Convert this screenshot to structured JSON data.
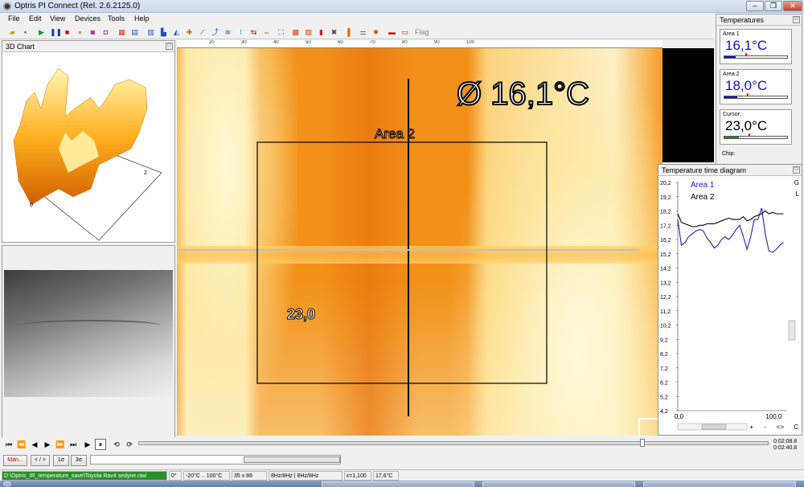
{
  "window": {
    "title": "Optris PI Connect (Rel. 2.6.2125.0)",
    "min_label": "–",
    "max_label": "❐",
    "close_label": "✕"
  },
  "menu": [
    "File",
    "Edit",
    "View",
    "Devices",
    "Tools",
    "Help"
  ],
  "toolbar": {
    "flag_label": "Flag"
  },
  "chart3d": {
    "title": "3D Chart",
    "axis_label_0": "0",
    "axis_label_2": "2"
  },
  "ruler": {
    "labels": [
      "20",
      "30",
      "40",
      "50",
      "60",
      "70",
      "80",
      "90",
      "100"
    ]
  },
  "thermal": {
    "mean_label": "Ø   16,1°C",
    "area_label": "Area 2",
    "cursor_label": "23,0"
  },
  "temperatures": {
    "title": "Temperatures",
    "items": [
      {
        "label": "Area 1",
        "value": "16,1°C",
        "color": "#1010c8",
        "level": 0.18
      },
      {
        "label": "Area 2",
        "value": "18,0°C",
        "color": "#1010c8",
        "level": 0.2
      },
      {
        "label": "Cursor:",
        "value": "23,0°C",
        "color": "#000000",
        "level": 0.23
      }
    ],
    "chip_label": "Chip:"
  },
  "time_diagram": {
    "title": "Temperature time diagram",
    "legend": [
      {
        "name": "Area 1",
        "color": "#2020c0"
      },
      {
        "name": "Area 2",
        "color": "#000000"
      }
    ],
    "side_labels": [
      "G",
      "L"
    ],
    "bottom_controls": [
      "+",
      "-",
      "<>",
      "C"
    ],
    "chart_data": {
      "type": "line",
      "xlabel": "",
      "ylabel": "",
      "x_ticks": [
        "0,0",
        "100,0"
      ],
      "xlim": [
        0,
        120
      ],
      "ylim": [
        4.2,
        20.2
      ],
      "y_ticks": [
        "20,2",
        "19,2",
        "18,2",
        "17,2",
        "16,2",
        "15,2",
        "14,2",
        "13,2",
        "12,2",
        "11,2",
        "10,2",
        "9,2",
        "8,2",
        "7,2",
        "6,2",
        "5,2",
        "4,2"
      ],
      "series": [
        {
          "name": "Area 1",
          "color": "#2020c0",
          "x": [
            0,
            4,
            8,
            12,
            16,
            20,
            24,
            28,
            32,
            36,
            40,
            44,
            48,
            52,
            56,
            60,
            64,
            68,
            72,
            76,
            80,
            84,
            88,
            92,
            96,
            100,
            104,
            108,
            112,
            116
          ],
          "y": [
            17.6,
            15.8,
            16.0,
            16.4,
            16.6,
            16.8,
            16.9,
            16.8,
            16.3,
            16.0,
            15.6,
            15.8,
            16.2,
            16.4,
            16.2,
            16.5,
            16.9,
            17.2,
            16.4,
            15.5,
            16.4,
            17.6,
            17.6,
            18.4,
            16.6,
            15.4,
            15.3,
            15.5,
            15.8,
            16.0
          ]
        },
        {
          "name": "Area 2",
          "color": "#000000",
          "x": [
            0,
            4,
            8,
            12,
            16,
            20,
            24,
            28,
            32,
            36,
            40,
            44,
            48,
            52,
            56,
            60,
            64,
            68,
            72,
            76,
            80,
            84,
            88,
            92,
            96,
            100,
            104,
            108,
            112,
            116
          ],
          "y": [
            18.0,
            17.4,
            17.3,
            17.2,
            17.1,
            17.1,
            17.2,
            17.2,
            17.3,
            17.3,
            17.3,
            17.4,
            17.5,
            17.6,
            17.7,
            17.6,
            17.6,
            17.6,
            17.8,
            17.5,
            17.6,
            17.8,
            17.9,
            18.0,
            18.2,
            18.0,
            18.1,
            18.0,
            18.0,
            18.0
          ]
        }
      ]
    }
  },
  "playback": {
    "time_top": "0:02:08.8",
    "time_bottom": "0:02:40.8",
    "buttons": [
      "⏮",
      "⏪",
      "◀",
      "▶",
      "⏩",
      "⏭",
      "▶",
      "⏸",
      "⟲",
      "⟳"
    ]
  },
  "controls": {
    "man_label": "Man...",
    "lr_label": "< / >",
    "sigma1_label": "1σ",
    "sigma3_label": "3σ"
  },
  "status": {
    "path": "D:\\Optris_IR_temperature_save\\Toyota Rav4 sedyne.ravi",
    "angle": "0°",
    "range": "-20°C .. 100°C",
    "resolution": "35 x 86",
    "rate": "8Hz/8Hz | 8Hz/8Hz",
    "emissivity": "ε=1,100",
    "ambient": "17,6°C"
  }
}
